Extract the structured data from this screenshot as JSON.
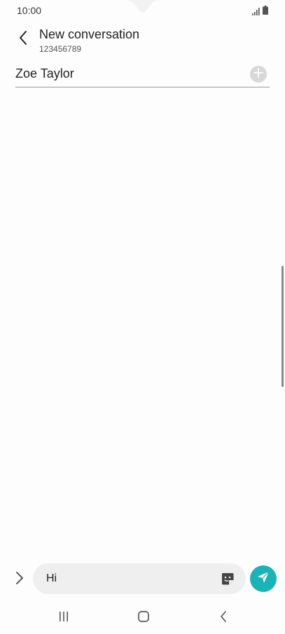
{
  "status_bar": {
    "time": "10:00",
    "icons": [
      "signal-icon",
      "battery-icon"
    ]
  },
  "header": {
    "title": "New conversation",
    "subtitle": "123456789",
    "back_icon": "chevron-left-icon"
  },
  "recipient": {
    "name": "Zoe Taylor",
    "add_icon": "plus-circle-icon"
  },
  "composer": {
    "message_value": "Hi",
    "expand_icon": "chevron-right-icon",
    "sticker_icon": "sticker-icon",
    "send_icon": "send-icon",
    "send_color": "#1ab3b8"
  },
  "nav_bar": {
    "icons": [
      "recents-icon",
      "home-icon",
      "back-icon"
    ]
  }
}
